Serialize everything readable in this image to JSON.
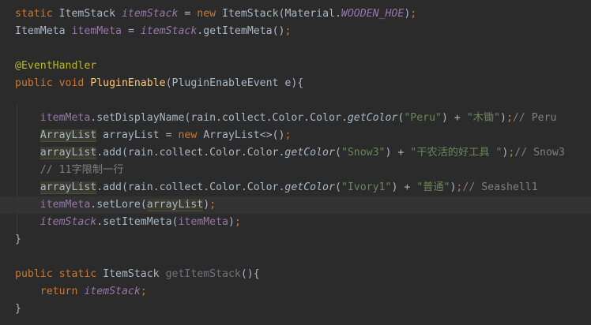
{
  "editor": {
    "lines": [
      {
        "tokens": [
          {
            "t": "static ",
            "c": "kw"
          },
          {
            "t": "ItemStack ",
            "c": "plain"
          },
          {
            "t": "itemStack",
            "c": "sfld"
          },
          {
            "t": " = ",
            "c": "plain"
          },
          {
            "t": "new ",
            "c": "kw"
          },
          {
            "t": "ItemStack(Material.",
            "c": "plain"
          },
          {
            "t": "WOODEN_HOE",
            "c": "sfld"
          },
          {
            "t": ")",
            "c": "plain"
          },
          {
            "t": ";",
            "c": "kw"
          }
        ]
      },
      {
        "tokens": [
          {
            "t": "ItemMeta ",
            "c": "plain"
          },
          {
            "t": "itemMeta",
            "c": "fld"
          },
          {
            "t": " = ",
            "c": "plain"
          },
          {
            "t": "itemStack",
            "c": "sfld"
          },
          {
            "t": ".getItemMeta()",
            "c": "plain"
          },
          {
            "t": ";",
            "c": "kw"
          }
        ]
      },
      {
        "tokens": []
      },
      {
        "tokens": [
          {
            "t": "@EventHandler",
            "c": "ann"
          }
        ]
      },
      {
        "tokens": [
          {
            "t": "public ",
            "c": "kw"
          },
          {
            "t": "void ",
            "c": "kw"
          },
          {
            "t": "PluginEnable",
            "c": "fn"
          },
          {
            "t": "(PluginEnableEvent e){",
            "c": "plain"
          }
        ]
      },
      {
        "tokens": []
      },
      {
        "tokens": [
          {
            "t": "    ",
            "c": "plain"
          },
          {
            "t": "itemMeta",
            "c": "fld"
          },
          {
            "t": ".setDisplayName(rain.collect.Color.Color.",
            "c": "plain"
          },
          {
            "t": "getColor",
            "c": "smeth"
          },
          {
            "t": "(",
            "c": "plain"
          },
          {
            "t": "\"Peru\"",
            "c": "str"
          },
          {
            "t": ") + ",
            "c": "plain"
          },
          {
            "t": "\"木锄\"",
            "c": "str"
          },
          {
            "t": ")",
            "c": "plain"
          },
          {
            "t": ";",
            "c": "kw"
          },
          {
            "t": "// Peru",
            "c": "cmt"
          }
        ]
      },
      {
        "tokens": [
          {
            "t": "    ",
            "c": "plain"
          },
          {
            "t": "ArrayList",
            "c": "plain",
            "h": "hl"
          },
          {
            "t": " arrayList = ",
            "c": "plain"
          },
          {
            "t": "new ",
            "c": "kw"
          },
          {
            "t": "ArrayList<>()",
            "c": "plain"
          },
          {
            "t": ";",
            "c": "kw"
          }
        ]
      },
      {
        "tokens": [
          {
            "t": "    ",
            "c": "plain"
          },
          {
            "t": "arrayList",
            "c": "plain",
            "h": "hl"
          },
          {
            "t": ".add(rain.collect.Color.Color.",
            "c": "plain"
          },
          {
            "t": "getColor",
            "c": "smeth"
          },
          {
            "t": "(",
            "c": "plain"
          },
          {
            "t": "\"Snow3\"",
            "c": "str"
          },
          {
            "t": ") + ",
            "c": "plain"
          },
          {
            "t": "\"干农活的好工具 \"",
            "c": "str"
          },
          {
            "t": ")",
            "c": "plain"
          },
          {
            "t": ";",
            "c": "kw"
          },
          {
            "t": "// Snow3",
            "c": "cmt"
          }
        ]
      },
      {
        "tokens": [
          {
            "t": "    ",
            "c": "plain"
          },
          {
            "t": "// 11字限制一行",
            "c": "cmt"
          }
        ]
      },
      {
        "tokens": [
          {
            "t": "    ",
            "c": "plain"
          },
          {
            "t": "arrayList",
            "c": "plain",
            "h": "hl"
          },
          {
            "t": ".add(rain.collect.Color.Color.",
            "c": "plain"
          },
          {
            "t": "getColor",
            "c": "smeth"
          },
          {
            "t": "(",
            "c": "plain"
          },
          {
            "t": "\"Ivory1\"",
            "c": "str"
          },
          {
            "t": ") + ",
            "c": "plain"
          },
          {
            "t": "\"普通\"",
            "c": "str"
          },
          {
            "t": ")",
            "c": "plain"
          },
          {
            "t": ";",
            "c": "kw"
          },
          {
            "t": "// Seashell1",
            "c": "cmt"
          }
        ]
      },
      {
        "current": true,
        "tokens": [
          {
            "t": "    ",
            "c": "plain"
          },
          {
            "t": "itemMeta",
            "c": "fld"
          },
          {
            "t": ".setLore(",
            "c": "plain"
          },
          {
            "t": "arrayList",
            "c": "plain",
            "h": "hl"
          },
          {
            "t": ")",
            "c": "plain"
          },
          {
            "t": ";",
            "c": "kw"
          }
        ]
      },
      {
        "tokens": [
          {
            "t": "    ",
            "c": "plain"
          },
          {
            "t": "itemStack",
            "c": "sfld"
          },
          {
            "t": ".setItemMeta(",
            "c": "plain"
          },
          {
            "t": "itemMeta",
            "c": "fld"
          },
          {
            "t": ")",
            "c": "plain"
          },
          {
            "t": ";",
            "c": "kw"
          }
        ]
      },
      {
        "tokens": [
          {
            "t": "}",
            "c": "plain"
          }
        ]
      },
      {
        "tokens": []
      },
      {
        "tokens": [
          {
            "t": "public ",
            "c": "kw"
          },
          {
            "t": "static ",
            "c": "kw"
          },
          {
            "t": "ItemStack ",
            "c": "plain"
          },
          {
            "t": "getItemStack",
            "c": "unused"
          },
          {
            "t": "(){",
            "c": "plain"
          }
        ]
      },
      {
        "tokens": [
          {
            "t": "    ",
            "c": "plain"
          },
          {
            "t": "return ",
            "c": "kw"
          },
          {
            "t": "itemStack",
            "c": "sfld"
          },
          {
            "t": ";",
            "c": "kw"
          }
        ]
      },
      {
        "tokens": [
          {
            "t": "}",
            "c": "plain"
          }
        ]
      }
    ]
  }
}
